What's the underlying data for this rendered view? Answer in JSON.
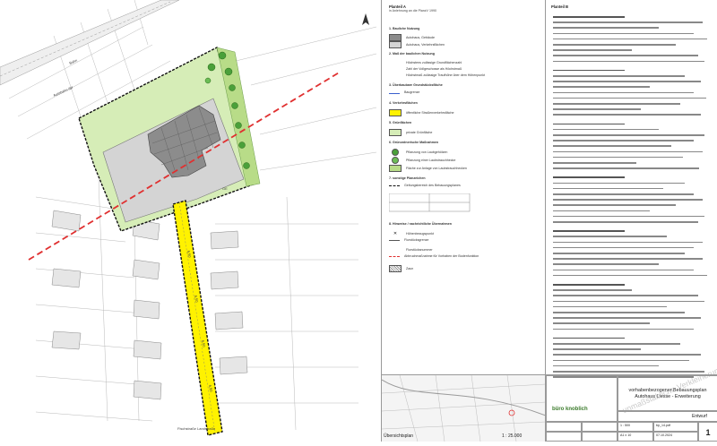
{
  "plan": {
    "labels": [
      "Bahn",
      "Autobahn-/Bf",
      "Fischstraße Landstraße",
      "6,50",
      "6,50",
      "6,50",
      "6,50",
      "GE"
    ]
  },
  "legend": {
    "header": "Planteil A",
    "subheader": "in Anlehnung an die PlanzV 1990",
    "rows": [
      {
        "text": "1. Bauliche Nutzung"
      },
      {
        "text": "Autohaus, Gebäude"
      },
      {
        "text": "Autohaus, Verkehrsflächen"
      },
      {
        "text": "2. Maß der baulichen Nutzung"
      },
      {
        "text": "Höchstens zulässige Grundflächenzahl"
      },
      {
        "text": "Zahl der Vollgeschosse als Höchstmaß"
      },
      {
        "text": "Höchstmaß zulässige Traufhöhe über dem Höhenpunkt"
      },
      {
        "text": "3. Überbaubare Grundstücksfläche"
      },
      {
        "text": "Baugrenze"
      },
      {
        "text": "4. Verkehrsflächen"
      },
      {
        "text": "öffentliche Straßenverkehrsfläche"
      },
      {
        "text": "5. Grünflächen"
      },
      {
        "text": "private Grünfläche"
      },
      {
        "text": "6. Grünordnerische Maßnahmen"
      },
      {
        "text": "Pflanzung von Laubgehölzen"
      },
      {
        "text": "Pflanzung einer Laubstrauchhecke"
      },
      {
        "text": "Fläche zur Anlage von Laubstrauchhecken"
      },
      {
        "text": "7. sonstige Planzeichen"
      },
      {
        "text": "Geltungsbereich des Bebauungsplanes"
      },
      {
        "text": "8. Hinweise / nachrichtliche Übernahmen"
      },
      {
        "text": "Höhenbezugspunkt"
      },
      {
        "text": "Flurstücksgrenze"
      },
      {
        "text": "Flurstücksnummer"
      },
      {
        "text": "Abbruchmaßnahme für Vorhaben der Bodenfunktion"
      },
      {
        "text": "Zaun"
      }
    ]
  },
  "notes": {
    "header": "Planteil B"
  },
  "overview": {
    "label": "Übersichtsplan",
    "scale": "1 : 25.000"
  },
  "titleblock": {
    "title_line1": "vorhabenbezogener Bebauungsplan",
    "title_line2": "Autohaus Liesse - Erweiterung",
    "company": "büro knoblich",
    "status": "Entwurf",
    "scale": "1 : 500",
    "date": "07.10.2024",
    "sheet_no": "1",
    "plan_no": "bp_14.pdf",
    "format": "A1 x 10"
  },
  "stamp": "unmaßstäbliche Verkleinerung",
  "colors": {
    "yellow": "#fff200",
    "green": "#c9e7a0",
    "building": "#8a8a8a",
    "paved": "#d6d6d6",
    "red": "#e03030",
    "boundary": "#111111"
  }
}
